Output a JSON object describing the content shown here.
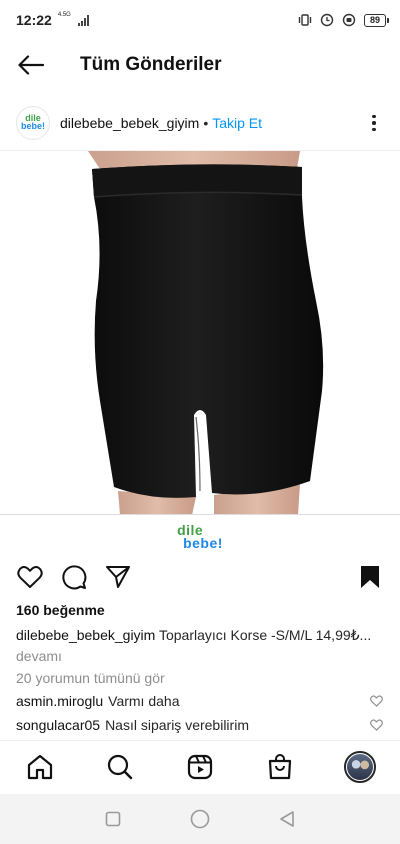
{
  "status_bar": {
    "time": "12:22",
    "network": "4.5G",
    "battery": "89"
  },
  "header": {
    "title": "Tüm Gönderiler"
  },
  "post": {
    "username": "dilebebe_bebek_giyim",
    "separator": "•",
    "follow_label": "Takip Et",
    "avatar_logo_top": "dile",
    "avatar_logo_bottom": "bebe!",
    "brand_logo_top": "dile",
    "brand_logo_bottom": "bebe!",
    "likes": "160 beğenme",
    "caption_user": "dilebebe_bebek_giyim",
    "caption_text": "Toparlayıcı Korse -S/M/L 14,99₺...",
    "caption_more": "devamı",
    "view_comments": "20 yorumun tümünü gör",
    "comments": [
      {
        "user": "asmin.miroglu",
        "text": "Varmı daha"
      },
      {
        "user": "songulacar05",
        "text": "Nasıl sipariş verebilirim"
      }
    ]
  },
  "icons": {
    "back": "arrow-left-icon",
    "more": "more-vertical-icon",
    "like": "heart-icon",
    "comment": "comment-bubble-icon",
    "share": "paper-plane-icon",
    "save": "bookmark-filled-icon",
    "home": "home-icon",
    "search": "search-icon",
    "reels": "reels-icon",
    "shop": "shopping-bag-icon"
  },
  "colors": {
    "accent": "#0095f6",
    "text": "#262626",
    "muted": "#8e8e8e",
    "logo_colors": [
      "#e53935",
      "#43a047",
      "#1e88e5",
      "#fb8c00",
      "#8e24aa"
    ]
  }
}
